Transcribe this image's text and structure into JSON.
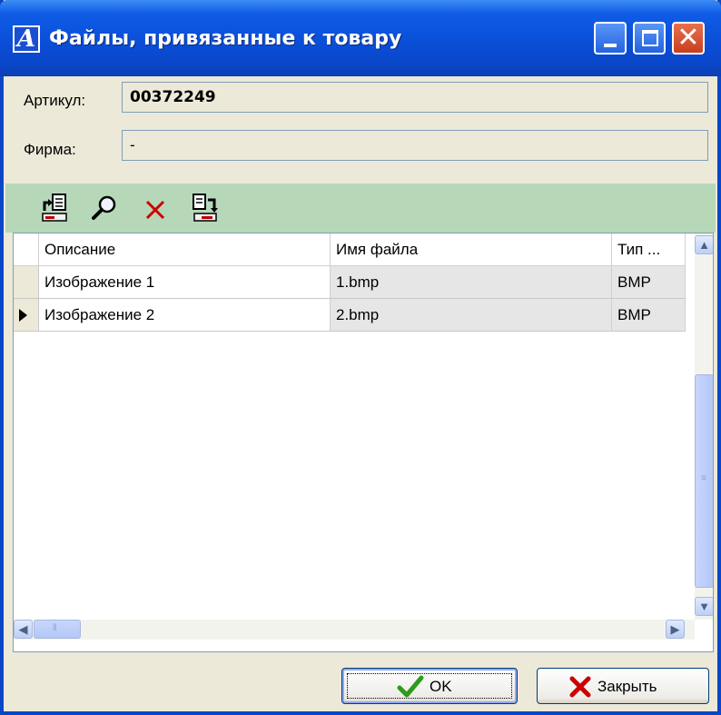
{
  "window": {
    "title": "Файлы, привязанные к товару",
    "app_icon": "A"
  },
  "fields": {
    "article_label": "Артикул:",
    "article_value": "00372249",
    "firm_label": "Фирма:",
    "firm_value": "-"
  },
  "toolbar": {
    "icons": [
      "add-file-icon",
      "search-icon",
      "delete-icon",
      "replace-file-icon"
    ]
  },
  "grid": {
    "columns": [
      "Описание",
      "Имя файла",
      "Тип ..."
    ],
    "rows": [
      {
        "description": "Изображение 1",
        "filename": "1.bmp",
        "type": "BMP",
        "current": false
      },
      {
        "description": "Изображение 2",
        "filename": "2.bmp",
        "type": "BMP",
        "current": true
      }
    ]
  },
  "buttons": {
    "ok_label": "OK",
    "close_label": "Закрыть"
  },
  "colors": {
    "titlebar": "#0a46c8",
    "toolbar_bg": "#b6d8b9",
    "window_bg": "#ece9d8",
    "delete_red": "#cc0000",
    "ok_green": "#2e9a1e"
  }
}
